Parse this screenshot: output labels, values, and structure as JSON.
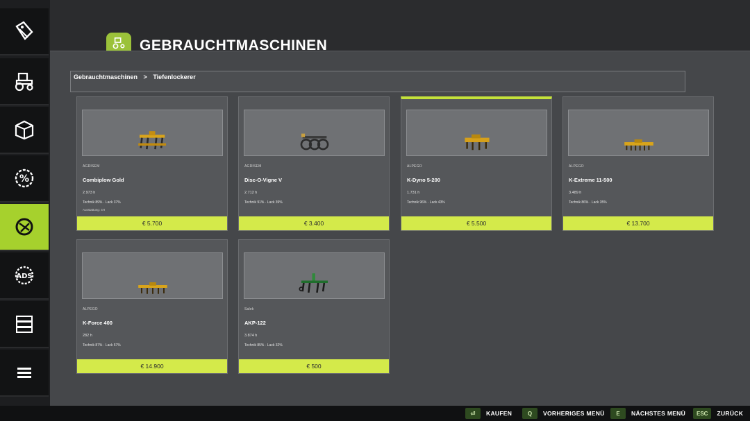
{
  "header": {
    "title": "GEBRAUCHTMASCHINEN"
  },
  "breadcrumb": {
    "items": [
      "Gebrauchtmaschinen",
      ">",
      "Tiefenlockerer"
    ]
  },
  "sidebar": {
    "items": [
      {
        "icon": "price-tag-icon"
      },
      {
        "icon": "tractor-icon"
      },
      {
        "icon": "crate-icon"
      },
      {
        "icon": "percent-badge-icon"
      },
      {
        "icon": "used-machines-icon"
      },
      {
        "icon": "ads-gear-icon"
      },
      {
        "icon": "server-icon"
      },
      {
        "icon": "menu-icon"
      }
    ]
  },
  "cards": [
    {
      "brand": "AGRISEM",
      "name": "Combiplow Gold",
      "hours": "2.973 h",
      "condition": "Technik 89% · Lack 37%",
      "extra": "Ausstattung: 4H",
      "price": "€ 5.700",
      "selected": false
    },
    {
      "brand": "AGRISEM",
      "name": "Disc-O-Vigne V",
      "hours": "2.712 h",
      "condition": "Technik 91% · Lack 39%",
      "extra": "",
      "price": "€ 3.400",
      "selected": false
    },
    {
      "brand": "ALPEGO",
      "name": "K-Dyno 5-200",
      "hours": "1.731 h",
      "condition": "Technik 96% · Lack 43%",
      "extra": "",
      "price": "€ 5.500",
      "selected": true
    },
    {
      "brand": "ALPEGO",
      "name": "K-Extreme 11-500",
      "hours": "3.489 h",
      "condition": "Technik 86% · Lack 35%",
      "extra": "",
      "price": "€ 13.700",
      "selected": false
    },
    {
      "brand": "ALPEGO",
      "name": "K-Force 400",
      "hours": "282 h",
      "condition": "Technik 87% · Lack 57%",
      "extra": "",
      "price": "€ 14.900",
      "selected": false
    },
    {
      "brand": "Salek",
      "name": "AKP-122",
      "hours": "3.874 h",
      "condition": "Technik 85% · Lack 32%",
      "extra": "",
      "price": "€ 500",
      "selected": false
    }
  ],
  "footer": {
    "buy": {
      "key": "⏎",
      "label": "KAUFEN"
    },
    "prev": {
      "key": "Q",
      "label": "VORHERIGES MENÜ"
    },
    "next": {
      "key": "E",
      "label": "NÄCHSTES MENÜ"
    },
    "back": {
      "key": "ESC",
      "label": "ZURÜCK"
    }
  },
  "colors": {
    "accent": "#a6d12d",
    "price_bar": "#d4ea4a",
    "selected_border": "#c4e23a"
  }
}
